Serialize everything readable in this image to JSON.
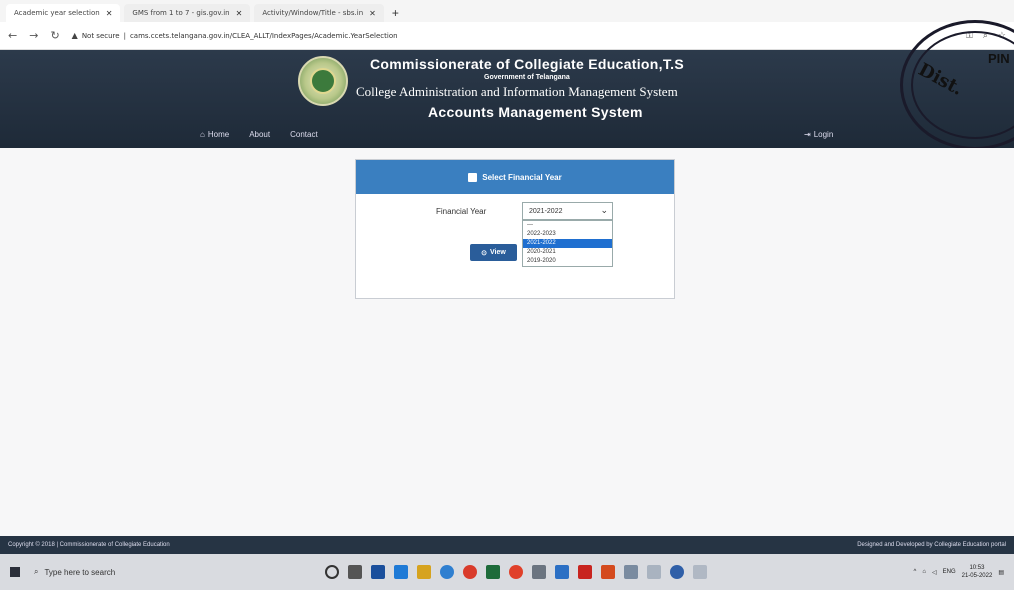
{
  "browser": {
    "tabs": [
      {
        "label": "Academic year selection"
      },
      {
        "label": "GMS from 1 to 7 - gis.gov.in"
      },
      {
        "label": "Activity/Window/Title - sbs.in"
      }
    ],
    "url": "cams.ccets.telangana.gov.in/CLEA_ALLT/IndexPages/Academic.YearSelection",
    "security_label": "Not secure"
  },
  "header": {
    "title": "Commissionerate of Collegiate Education,T.S",
    "government": "Government of Telangana",
    "subtitle": "College Administration and Information Management System",
    "system": "Accounts Management System",
    "nav": [
      {
        "label": "Home",
        "icon": "home-icon"
      },
      {
        "label": "About"
      },
      {
        "label": "Contact"
      }
    ],
    "login": "Login"
  },
  "stamp": {
    "text1": "Dist.",
    "text2": "PIN"
  },
  "panel": {
    "title": "Select Financial Year",
    "financial_year_label": "Financial Year",
    "selected_value": "2021-2022",
    "options": [
      "---",
      "2022-2023",
      "2021-2022",
      "2020-2021",
      "2019-2020"
    ],
    "selected_index": 2,
    "view_button": "View"
  },
  "footer": {
    "left": "Copyright © 2018 | Commissionerate of Collegiate Education",
    "right": "Designed and Developed by Collegiate Education portal"
  },
  "taskbar": {
    "search_placeholder": "Type here to search",
    "language": "ENG",
    "time": "10:53",
    "date": "21-05-2022"
  }
}
